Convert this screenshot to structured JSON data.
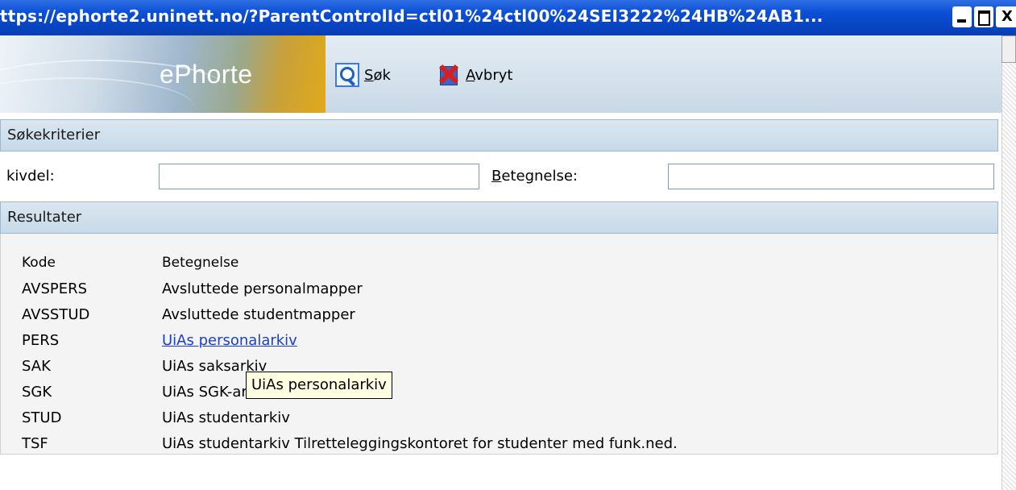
{
  "window": {
    "title": "ttps://ephorte2.uninett.no/?ParentControlId=ctl01%24ctl00%24SEI3222%24HB%24AB1...",
    "minimize_glyph": "_",
    "maximize_glyph": "□",
    "close_glyph": "X"
  },
  "header": {
    "logo_text": "ePhorte",
    "toolbar": {
      "search_label": "Søk",
      "cancel_label": "Avbryt"
    }
  },
  "criteria": {
    "title": "Søkekriterier",
    "arkivdel_label": "kivdel:",
    "arkivdel_value": "",
    "betegnelse_label": "Betegnelse:",
    "betegnelse_value": ""
  },
  "results": {
    "title": "Resultater",
    "columns": [
      "Kode",
      "Betegnelse"
    ],
    "rows": [
      {
        "code": "AVSPERS",
        "name": "Avsluttede personalmapper"
      },
      {
        "code": "AVSSTUD",
        "name": "Avsluttede studentmapper"
      },
      {
        "code": "PERS",
        "name": "UiAs personalarkiv"
      },
      {
        "code": "SAK",
        "name": "UiAs saksarkiv"
      },
      {
        "code": "SGK",
        "name": "UiAs SGK-arkiv"
      },
      {
        "code": "STUD",
        "name": "UiAs studentarkiv"
      },
      {
        "code": "TSF",
        "name": "UiAs studentarkiv Tilretteleggingskontoret for studenter med funk.ned."
      }
    ]
  },
  "tooltip": {
    "text": "UiAs personalarkiv"
  },
  "colors": {
    "titlebar": "#0a4fd6",
    "section_header": "#c7d9e8",
    "link": "#1a3fd0",
    "tooltip_bg": "#ffffe1"
  }
}
